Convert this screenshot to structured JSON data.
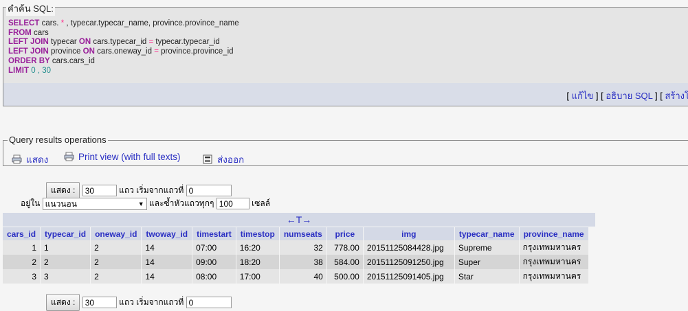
{
  "sql_section": {
    "legend": "คำค้น SQL:",
    "lines": [
      {
        "kw": "SELECT",
        "rest": " cars. ",
        "op": "*",
        "rest2": " , typecar.typecar_name, province.province_name"
      },
      {
        "kw": "FROM",
        "rest": " cars",
        "op": "",
        "rest2": ""
      },
      {
        "kw": "LEFT JOIN",
        "rest": " typecar ",
        "kw2": "ON",
        "rest3": " cars.typecar_id ",
        "op": "=",
        "rest2": " typecar.typecar_id"
      },
      {
        "kw": "LEFT JOIN",
        "rest": " province ",
        "kw2": "ON",
        "rest3": " cars.oneway_id ",
        "op": "=",
        "rest2": " province.province_id"
      },
      {
        "kw": "ORDER BY",
        "rest": " cars.cars_id",
        "op": "",
        "rest2": ""
      },
      {
        "kw": "LIMIT",
        "rest": "",
        "num1": "0",
        "sep": " , ",
        "num2": "30"
      }
    ],
    "links": {
      "edit": "แก้ไข",
      "explain": "อธิบาย SQL",
      "create": "สร้างโ"
    }
  },
  "query_ops": {
    "legend": "Query results operations",
    "print": "แสดง",
    "print_full": "Print view (with full texts)",
    "export": "ส่งออก"
  },
  "nav": {
    "show_button": "แสดง :",
    "rows_value": "30",
    "rows_label": "แถว เริ่มจากแถวที่",
    "start_value": "0",
    "in_label": "อยู่ใน",
    "mode_value": "แนวนอน",
    "repeat_label": "และซ้ำหัวแถวทุกๆ",
    "repeat_value": "100",
    "cells_label": "เซลล์"
  },
  "results": {
    "columns": [
      "cars_id",
      "typecar_id",
      "oneway_id",
      "twoway_id",
      "timestart",
      "timestop",
      "numseats",
      "price",
      "img",
      "typecar_name",
      "province_name"
    ],
    "rows": [
      [
        "1",
        "1",
        "2",
        "14",
        "07:00",
        "16:20",
        "32",
        "778.00",
        "20151125084428.jpg",
        "Supreme",
        "กรุงเทพมหานคร"
      ],
      [
        "2",
        "2",
        "2",
        "14",
        "09:00",
        "18:20",
        "38",
        "584.00",
        "20151125091250.jpg",
        "Super",
        "กรุงเทพมหานคร"
      ],
      [
        "3",
        "3",
        "2",
        "14",
        "08:00",
        "17:00",
        "40",
        "500.00",
        "20151125091405.jpg",
        "Star",
        "กรุงเทพมหานคร"
      ]
    ]
  },
  "colors": {
    "keyword": "#99209a",
    "link": "#2a2fc3",
    "header_bg": "#d4d9e6"
  }
}
